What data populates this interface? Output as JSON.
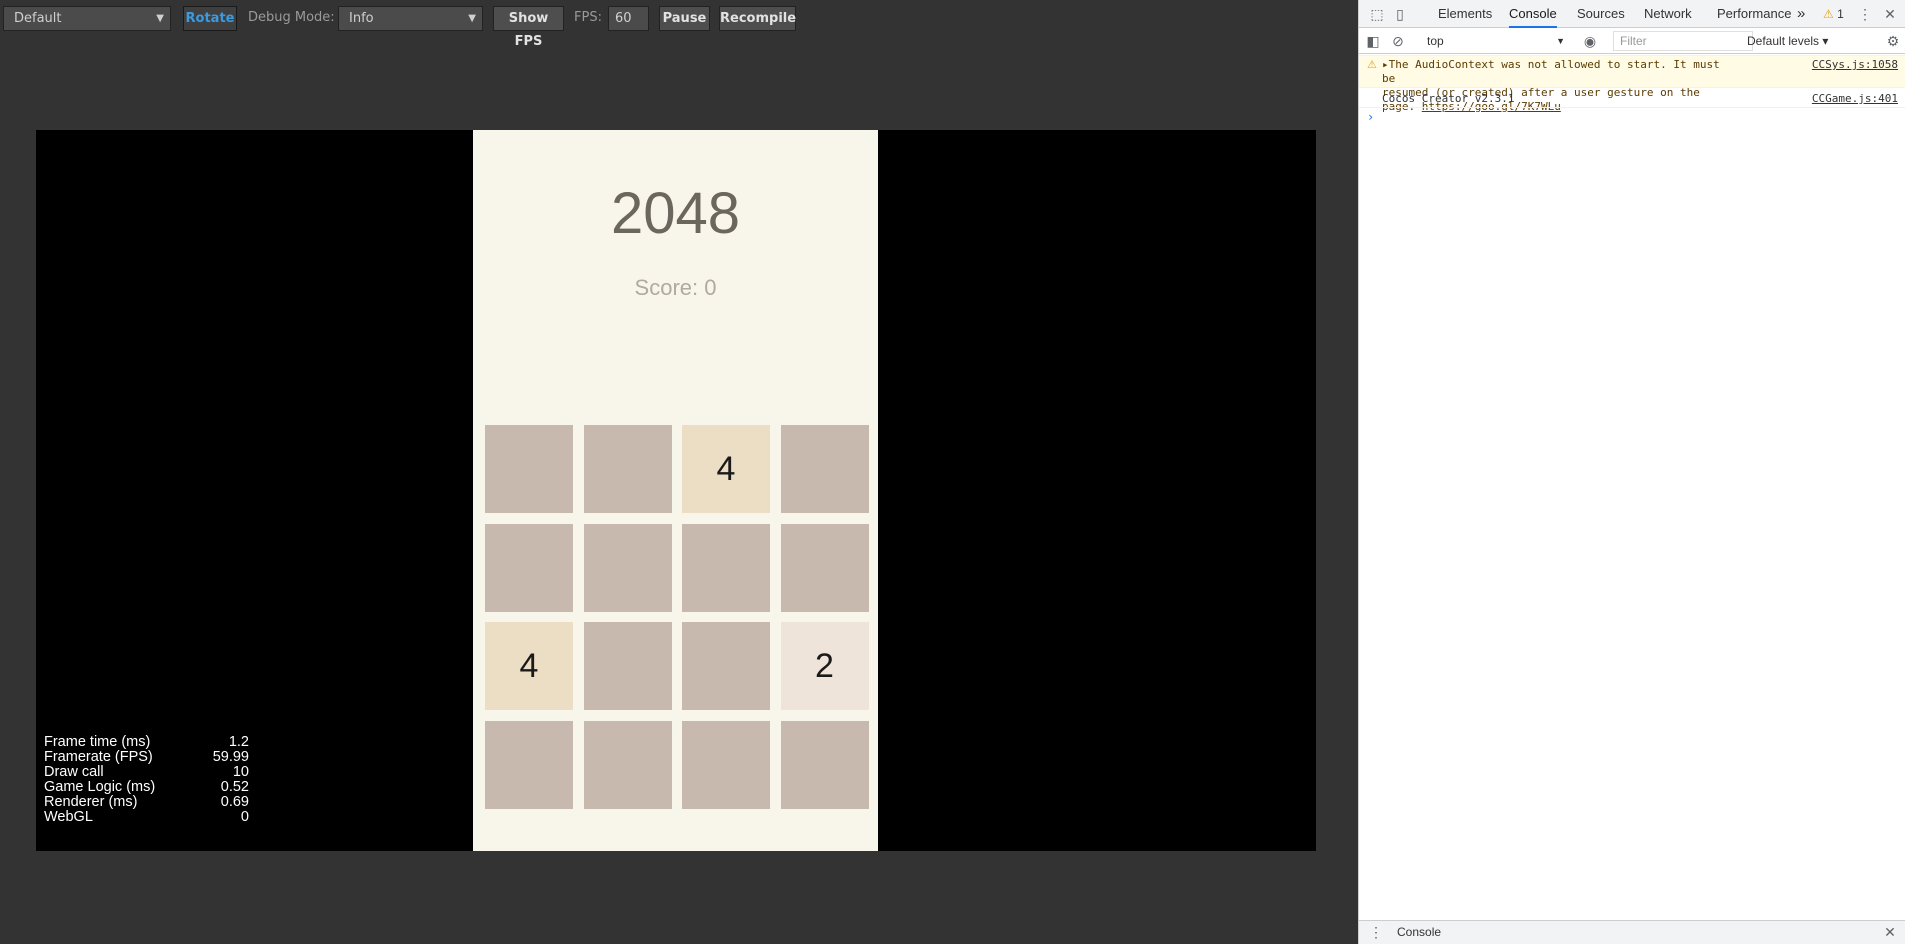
{
  "toolbar": {
    "device_select": "Default",
    "rotate_label": "Rotate",
    "debug_mode_label": "Debug Mode:",
    "debug_mode_value": "Info",
    "show_fps_label": "Show FPS",
    "fps_label": "FPS:",
    "fps_value": "60",
    "pause_label": "Pause",
    "recompile_label": "Recompile"
  },
  "game": {
    "title": "2048",
    "score_text": "Score: 0",
    "board": [
      [
        "",
        "",
        "4",
        ""
      ],
      [
        "",
        "",
        "",
        ""
      ],
      [
        "4",
        "",
        "",
        "2"
      ],
      [
        "",
        "",
        "",
        ""
      ]
    ]
  },
  "stats": [
    {
      "label": "Frame time (ms)",
      "value": "1.2"
    },
    {
      "label": "Framerate (FPS)",
      "value": "59.99"
    },
    {
      "label": "Draw call",
      "value": "10"
    },
    {
      "label": "Game Logic (ms)",
      "value": "0.52"
    },
    {
      "label": "Renderer (ms)",
      "value": "0.69"
    },
    {
      "label": "WebGL",
      "value": "0"
    }
  ],
  "devtools": {
    "tabs": [
      "Elements",
      "Console",
      "Sources",
      "Network",
      "Performance"
    ],
    "active_tab": "Console",
    "more_tabs": "»",
    "warning_count": "1",
    "context": "top",
    "filter_placeholder": "Filter",
    "levels": "Default levels ▾",
    "messages": {
      "warning_line1": "The AudioContext was not allowed to start. It must be",
      "warning_line2": "resumed (or created) after a user gesture on the page.",
      "warning_link": "https://goo.gl/7K7WLu",
      "warning_source": "CCSys.js:1058",
      "info_text": "Cocos Creator v2.3.1",
      "info_source": "CCGame.js:401"
    },
    "prompt": "›",
    "drawer_tab": "Console"
  },
  "colors": {
    "tile_empty": "#c7b9ae",
    "tile_2": "#eee4da",
    "tile_4": "#ecdec5",
    "game_bg": "#f8f5eb",
    "accent_blue": "#1a73e8"
  }
}
